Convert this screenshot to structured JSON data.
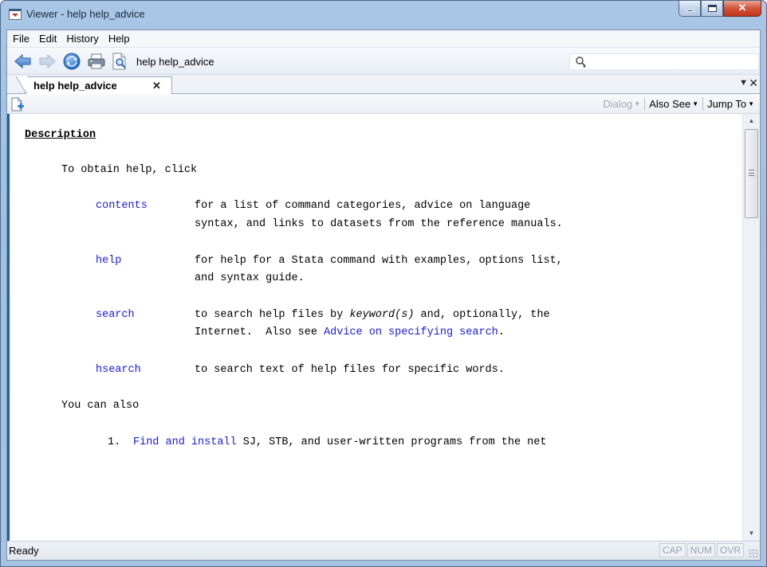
{
  "window": {
    "title": "Viewer - help help_advice"
  },
  "menu": {
    "items": [
      "File",
      "Edit",
      "History",
      "Help"
    ]
  },
  "toolbar": {
    "address_value": "help help_advice",
    "search_value": "",
    "icons": [
      "back-arrow-icon",
      "forward-arrow-icon",
      "refresh-icon",
      "print-icon",
      "find-icon",
      "search-icon"
    ]
  },
  "tabs": {
    "active_label": "help help_advice",
    "close_glyph": "✕",
    "dropdown_glyph": "▼",
    "close_all_glyph": "✕"
  },
  "viewer_toolbar": {
    "dialog_label": "Dialog",
    "also_see_label": "Also See",
    "jump_to_label": "Jump To"
  },
  "document": {
    "heading": "Description",
    "intro": "To obtain help, click",
    "entries": [
      {
        "link": "contents",
        "desc_line1": "for a list of command categories, advice on language",
        "desc_line2": "syntax, and links to datasets from the reference manuals."
      },
      {
        "link": "help",
        "desc_line1": "for help for a Stata command with examples, options list,",
        "desc_line2": "and syntax guide."
      },
      {
        "link": "search",
        "desc_line1_a": "to search help files by ",
        "desc_line1_italic": "keyword(s)",
        "desc_line1_b": " and, optionally, the",
        "desc_line2_a": "Internet.  Also see ",
        "desc_line2_link": "Advice on specifying search",
        "desc_line2_b": "."
      },
      {
        "link": "hsearch",
        "desc_line1": "to search text of help files for specific words."
      }
    ],
    "also_intro": "You can also",
    "numbered": [
      {
        "number": "1.",
        "link": "Find and install",
        "rest": " SJ, STB, and user-written programs from the net"
      }
    ]
  },
  "status": {
    "text": "Ready",
    "indicators": [
      "CAP",
      "NUM",
      "OVR"
    ]
  },
  "colors": {
    "link": "#1a1ae0",
    "title_bar": "#a9c6e6",
    "close_button": "#c2351c"
  }
}
